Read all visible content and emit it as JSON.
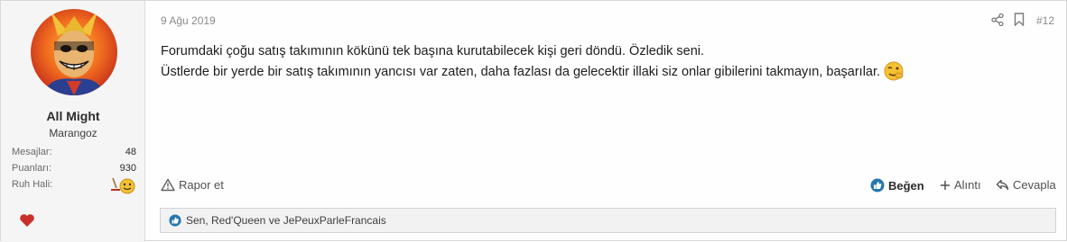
{
  "user": {
    "name": "All Might",
    "title": "Marangoz",
    "stats": [
      {
        "label": "Mesajlar:",
        "value": "48"
      },
      {
        "label": "Puanları:",
        "value": "930"
      },
      {
        "label": "Ruh Hali:",
        "value": ""
      }
    ],
    "mood_icon": "smiling-face-icon",
    "reaction_icon": "heart-icon"
  },
  "post": {
    "date": "9 Ağu 2019",
    "number": "#12",
    "lines": [
      "Forumdaki çoğu satış takımının kökünü tek başına kurutabilecek kişi geri döndü. Özledik seni.",
      "Üstlerde bir yerde bir satış takımının yancısı var zaten, daha fazlası da gelecektir illaki siz onlar gibilerini takmayın, başarılar."
    ],
    "emoji": "winking-face-icon"
  },
  "actions": {
    "report": "Rapor et",
    "like": "Beğen",
    "quote": "Alıntı",
    "reply": "Cevapla"
  },
  "likes": {
    "text": "Sen, Red'Queen ve JePeuxParleFrancais"
  },
  "colors": {
    "like_blue": "#2577b1",
    "heart_red": "#c9302c",
    "emoji_yellow": "#f5c133"
  }
}
